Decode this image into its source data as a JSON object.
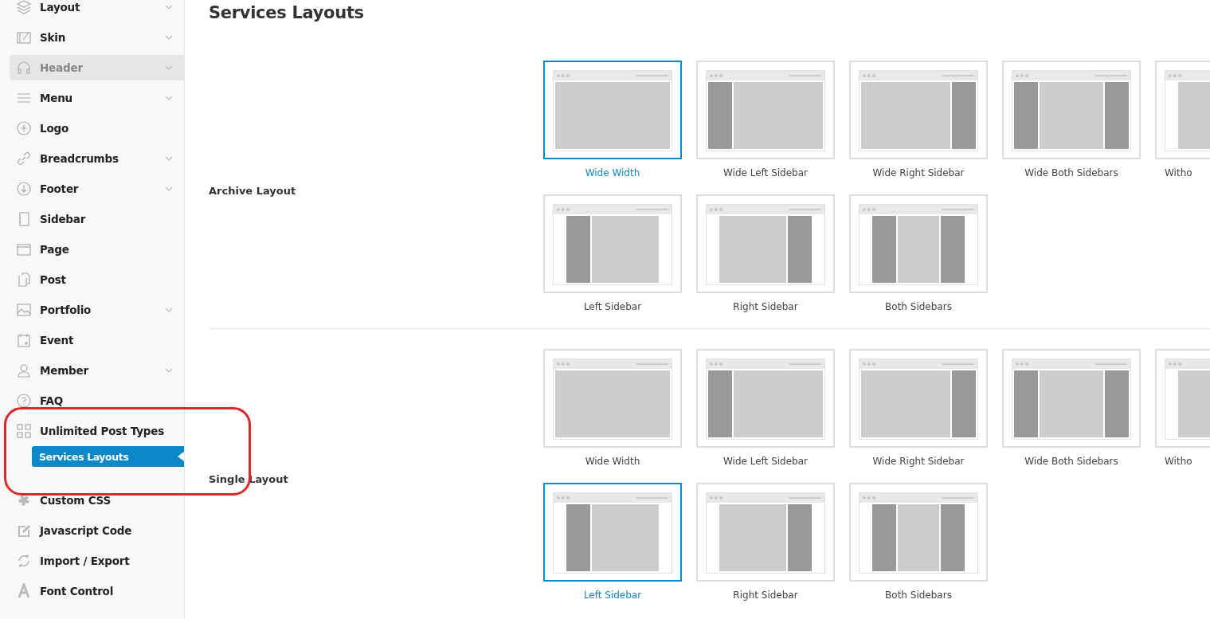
{
  "sidebar": {
    "items": [
      {
        "label": "Layout",
        "expandable": true,
        "highlighted": false,
        "selected": false
      },
      {
        "label": "Skin",
        "expandable": true,
        "highlighted": false,
        "selected": false
      },
      {
        "label": "Header",
        "expandable": true,
        "highlighted": true,
        "selected": false
      },
      {
        "label": "Menu",
        "expandable": true,
        "highlighted": false,
        "selected": false
      },
      {
        "label": "Logo",
        "expandable": false,
        "highlighted": false,
        "selected": false
      },
      {
        "label": "Breadcrumbs",
        "expandable": true,
        "highlighted": false,
        "selected": false
      },
      {
        "label": "Footer",
        "expandable": true,
        "highlighted": false,
        "selected": false
      },
      {
        "label": "Sidebar",
        "expandable": false,
        "highlighted": false,
        "selected": false
      },
      {
        "label": "Page",
        "expandable": false,
        "highlighted": false,
        "selected": false
      },
      {
        "label": "Post",
        "expandable": false,
        "highlighted": false,
        "selected": false
      },
      {
        "label": "Portfolio",
        "expandable": true,
        "highlighted": false,
        "selected": false
      },
      {
        "label": "Event",
        "expandable": false,
        "highlighted": false,
        "selected": false
      },
      {
        "label": "Member",
        "expandable": true,
        "highlighted": false,
        "selected": false
      },
      {
        "label": "FAQ",
        "expandable": false,
        "highlighted": false,
        "selected": false
      },
      {
        "label": "Unlimited Post Types",
        "expandable": false,
        "highlighted": false,
        "selected": false,
        "children": [
          {
            "label": "Services Layouts",
            "selected": true
          }
        ]
      },
      {
        "label": "Custom CSS",
        "expandable": false,
        "highlighted": false,
        "selected": false
      },
      {
        "label": "Javascript Code",
        "expandable": false,
        "highlighted": false,
        "selected": false
      },
      {
        "label": "Import / Export",
        "expandable": false,
        "highlighted": false,
        "selected": false
      },
      {
        "label": "Font Control",
        "expandable": false,
        "highlighted": false,
        "selected": false
      }
    ]
  },
  "title": "Services Layouts",
  "sections": [
    {
      "label": "Archive Layout",
      "options": [
        {
          "kind": "wide-full",
          "label": "Wide Width",
          "selected": true
        },
        {
          "kind": "wide-left",
          "label": "Wide Left Sidebar",
          "selected": false
        },
        {
          "kind": "wide-right",
          "label": "Wide Right Sidebar",
          "selected": false
        },
        {
          "kind": "wide-both",
          "label": "Wide Both Sidebars",
          "selected": false
        },
        {
          "kind": "boxed-none",
          "label": "Witho",
          "selected": false
        },
        {
          "kind": "boxed-left",
          "label": "Left Sidebar",
          "selected": false
        },
        {
          "kind": "boxed-right",
          "label": "Right Sidebar",
          "selected": false
        },
        {
          "kind": "boxed-both",
          "label": "Both Sidebars",
          "selected": false
        }
      ]
    },
    {
      "label": "Single Layout",
      "options": [
        {
          "kind": "wide-full",
          "label": "Wide Width",
          "selected": false
        },
        {
          "kind": "wide-left",
          "label": "Wide Left Sidebar",
          "selected": false
        },
        {
          "kind": "wide-right",
          "label": "Wide Right Sidebar",
          "selected": false
        },
        {
          "kind": "wide-both",
          "label": "Wide Both Sidebars",
          "selected": false
        },
        {
          "kind": "boxed-none",
          "label": "Witho",
          "selected": false
        },
        {
          "kind": "boxed-left",
          "label": "Left Sidebar",
          "selected": true
        },
        {
          "kind": "boxed-right",
          "label": "Right Sidebar",
          "selected": false
        },
        {
          "kind": "boxed-both",
          "label": "Both Sidebars",
          "selected": false
        }
      ]
    }
  ]
}
